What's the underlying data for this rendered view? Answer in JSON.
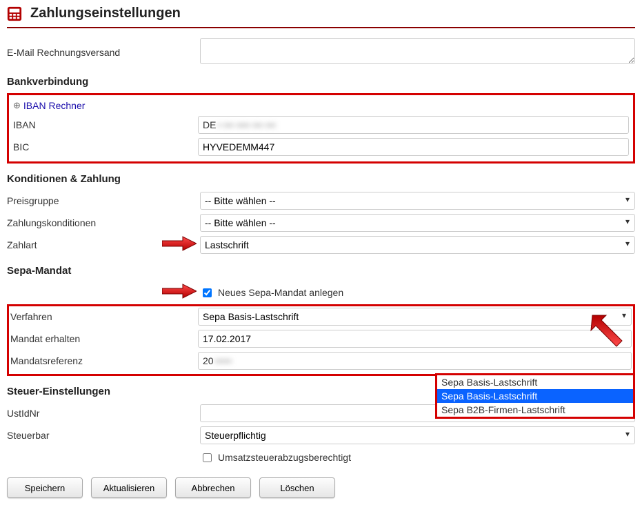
{
  "page": {
    "title": "Zahlungseinstellungen"
  },
  "email": {
    "label": "E-Mail Rechnungsversand",
    "value": ""
  },
  "bank": {
    "heading": "Bankverbindung",
    "calc_link": "IBAN Rechner",
    "iban_label": "IBAN",
    "iban_prefix": "DE",
    "iban_rest": "• •••  ••••  •••  •••",
    "bic_label": "BIC",
    "bic_value": "HYVEDEMM447"
  },
  "konditionen": {
    "heading": "Konditionen & Zahlung",
    "preisgruppe_label": "Preisgruppe",
    "preisgruppe_value": "-- Bitte wählen --",
    "zahlungskonditionen_label": "Zahlungskonditionen",
    "zahlungskonditionen_value": "-- Bitte wählen --",
    "zahlart_label": "Zahlart",
    "zahlart_value": "Lastschrift"
  },
  "sepa": {
    "heading": "Sepa-Mandat",
    "neu_checkbox_label": "Neues Sepa-Mandat anlegen",
    "neu_checked": true,
    "verfahren_label": "Verfahren",
    "verfahren_value": "Sepa Basis-Lastschrift",
    "mandat_erhalten_label": "Mandat erhalten",
    "mandat_erhalten_value": "17.02.2017",
    "mandatsreferenz_label": "Mandatsreferenz",
    "mandatsreferenz_prefix": "20",
    "mandatsreferenz_rest": "•••••"
  },
  "sepa_options": {
    "opt0": "Sepa Basis-Lastschrift",
    "opt1": "Sepa Basis-Lastschrift",
    "opt2": "Sepa B2B-Firmen-Lastschrift"
  },
  "steuer": {
    "heading": "Steuer-Einstellungen",
    "ustid_label": "UstIdNr",
    "ustid_value": "",
    "steuerbar_label": "Steuerbar",
    "steuerbar_value": "Steuerpflichtig",
    "umsatz_checkbox_label": "Umsatzsteuerabzugsberechtigt",
    "umsatz_checked": false
  },
  "buttons": {
    "save": "Speichern",
    "refresh": "Aktualisieren",
    "cancel": "Abbrechen",
    "delete": "Löschen"
  }
}
